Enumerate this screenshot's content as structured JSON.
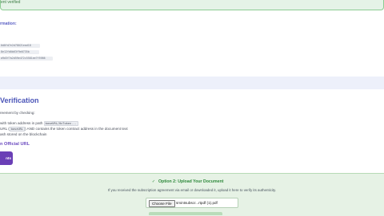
{
  "banner": {
    "text": "ent verified"
  },
  "info": {
    "label": "rmation:",
    "hashes": [
      "0d8fd7e2d78021ead18",
      "8e12fd0b63f9e0735b",
      "a9d3f7a2d59e472c5581ee7f5986"
    ]
  },
  "verification": {
    "title": "Verification",
    "line1": "reement by checking:",
    "line2_prefix": "with token address in path",
    "line2_code": "baseURL/0xToken...",
    "line3_prefix": "URL (",
    "line3_code": "baseURL",
    "line3_suffix": ") AND contains the token contract address in the document text",
    "line4": "ash stored on the blockchain",
    "official_url": "n Official URL",
    "button_label": "nts"
  },
  "upload": {
    "check_glyph": "✓",
    "title": "Option 2: Upload Your Document",
    "subtitle": "If you received the subscription agreement via email or downloaded it, upload it here to verify its authenticity.",
    "choose_label": "Choose File",
    "file_name": "smintsubscr...rtpdf (1).pdf"
  },
  "colors": {
    "accent_purple": "#6a3fb6",
    "title_indigo": "#4b55b8",
    "success_green": "#2f8a3c",
    "panel_green": "#e6f2e5"
  }
}
